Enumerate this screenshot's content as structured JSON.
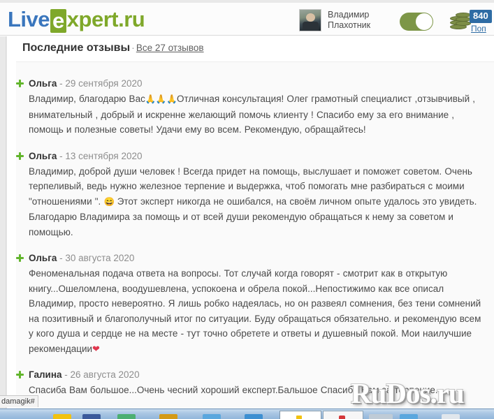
{
  "header": {
    "logo": {
      "part1": "Live",
      "part2": "e",
      "part3": "xpert.ru"
    },
    "user": {
      "name_line1": "Владимир",
      "name_line2": "Плахотник",
      "avatar_name": "user-avatar"
    },
    "toggle": {
      "state": "on",
      "label": "online-status-toggle"
    },
    "balance": {
      "amount": "840",
      "topup_label": "Поп"
    }
  },
  "section": {
    "title": "Последние отзывы",
    "separator": "·",
    "all_reviews_link": "Все 27 отзывов"
  },
  "reviews": [
    {
      "author": "Ольга",
      "dash": " - ",
      "date": "29 сентября 2020",
      "text_before": "Владимир, благодарю Вас",
      "emoji": "🙏🙏🙏",
      "text_after": "Отличная консультация! Олег грамотный специалист ,отзывчивый , внимательный , добрый и искренне желающий помочь клиенту ! Спасибо ему за его внимание , помощь и полезные советы! Удачи ему во всем. Рекомендую, обращайтесь!"
    },
    {
      "author": "Ольга",
      "dash": " - ",
      "date": "13 сентября 2020",
      "text_before": "Владимир, доброй души человек ! Всегда придет на помощь, выслушает и поможет советом. Очень терпеливый, ведь нужно железное терпение и выдержка, чтоб помогать мне разбираться с моими \"отношениями \". ",
      "emoji": "😄",
      "text_after": " Этот эксперт никогда не ошибался, на своём личном опыте удалось это увидеть. Благодарю Владимира за помощь и от всей души рекомендую обращаться к нему за советом и помощью."
    },
    {
      "author": "Ольга",
      "dash": " - ",
      "date": "30 августа 2020",
      "text_before": "Феноменальная подача ответа на вопросы. Тот случай когда говорят - смотрит как в открытую книгу...Ошеломлена, воодушевлена, успокоена и обрела покой...Непостижимо как все описал Владимир, просто невероятно. Я лишь робко надеялась, но он развеял сомнения, без тени сомнений на позитивный и благополучный итог по ситуации. Буду обращаться обязательно. и рекомендую всем у кого душа и сердце не на месте - тут точно обретете и ответы и душевный покой. Мои наилучшие рекомендации",
      "emoji": "❤",
      "text_after": ""
    },
    {
      "author": "Галина",
      "dash": " - ",
      "date": "26 августа 2020",
      "text_before": "Спасиба Вам большое...Очень чесний хороший експерт.Бальшое Спасиба Вам за терпение...",
      "emoji": "",
      "text_after": ""
    }
  ],
  "watermark": {
    "text": "RuDos.ru"
  },
  "browser": {
    "status_text": "damagik#"
  }
}
